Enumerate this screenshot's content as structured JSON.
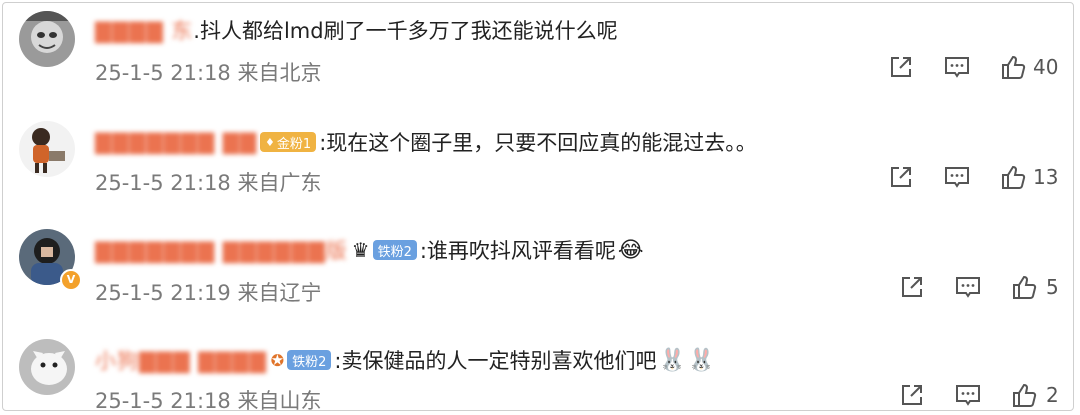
{
  "comments": [
    {
      "username": "▇▇▇▇ 东",
      "badge": "",
      "text": ".抖人都给lmd刷了一千多万了我还能说什么呢",
      "time": "25-1-5 21:18",
      "location": "来自北京",
      "likes": "40"
    },
    {
      "username": "▇▇▇▇▇▇▇ ▇▇",
      "badge": "金粉1",
      "text": ":现在这个圈子里，只要不回应真的能混过去。。",
      "time": "25-1-5 21:18",
      "location": "来自广东",
      "likes": "13"
    },
    {
      "username": "▇▇▇▇▇▇▇ ▇▇▇▇▇▇版",
      "badge": "铁粉2",
      "text": ":谁再吹抖风评看看呢",
      "time": "25-1-5 21:19",
      "location": "来自辽宁",
      "likes": "5"
    },
    {
      "username": "小狗▇▇▇ ▇▇▇▇",
      "badge": "铁粉2",
      "text": ":卖保健品的人一定特别喜欢他们吧",
      "time": "25-1-5 21:18",
      "location": "来自山东",
      "likes": "2"
    }
  ],
  "icons": {
    "share": "share-icon",
    "comment": "comment-icon",
    "like": "thumbs-up-icon",
    "vip": "verified-v-icon",
    "crown": "crown-icon",
    "laugh": "laughing-emoji",
    "bunny": "bunny-emoji"
  },
  "colors": {
    "username": "#eb7350",
    "meta": "#7a7a7a",
    "gold_badge": "#f0b342",
    "iron_badge": "#6aa0e0"
  }
}
